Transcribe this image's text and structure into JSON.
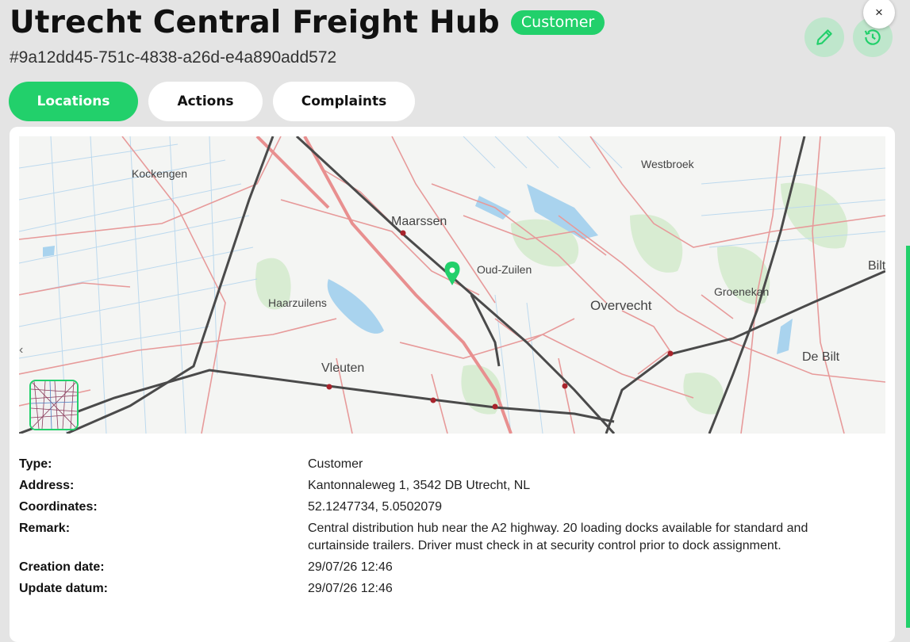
{
  "header": {
    "title": "Utrecht Central Freight Hub",
    "badge": "Customer",
    "uuid": "#9a12dd45-751c-4838-a26d-e4a890add572",
    "edit_icon": "pencil-icon",
    "history_icon": "history-icon",
    "close_label": "×"
  },
  "tabs": [
    {
      "label": "Locations",
      "active": true
    },
    {
      "label": "Actions",
      "active": false
    },
    {
      "label": "Complaints",
      "active": false
    }
  ],
  "map": {
    "labels": {
      "kockengen": "Kockengen",
      "westbroek": "Westbroek",
      "maarssen": "Maarssen",
      "oud_zuilen": "Oud-Zuilen",
      "bilt": "Bilt",
      "groenekan": "Groenekan",
      "haarzuilens": "Haarzuilens",
      "overvecht": "Overvecht",
      "de_bilt": "De Bilt",
      "vleuten": "Vleuten"
    },
    "marker_color": "#22d06b",
    "collapse_glyph": "‹"
  },
  "details": {
    "type_label": "Type:",
    "type_value": "Customer",
    "address_label": "Address:",
    "address_value": "Kantonnaleweg 1, 3542 DB Utrecht, NL",
    "coordinates_label": "Coordinates:",
    "coordinates_value": "52.1247734, 5.0502079",
    "remark_label": "Remark:",
    "remark_value": "Central distribution hub near the A2 highway. 20 loading docks available for standard and curtainside trailers. Driver must check in at security control prior to dock assignment.",
    "creation_label": "Creation date:",
    "creation_value": "29/07/26 12:46",
    "update_label": "Update datum:",
    "update_value": "29/07/26 12:46"
  },
  "colors": {
    "accent": "#22d06b",
    "background": "#e4e4e4"
  }
}
